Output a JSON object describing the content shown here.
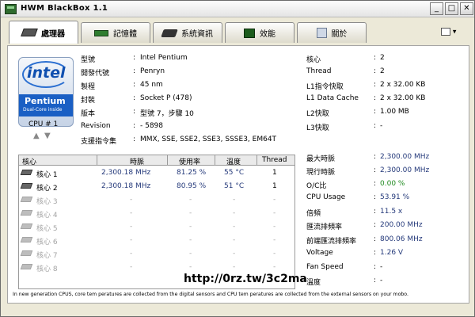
{
  "window": {
    "title": "HWM BlackBox 1.1"
  },
  "tabs": [
    {
      "label": "處理器"
    },
    {
      "label": "記憶體"
    },
    {
      "label": "系統資訊"
    },
    {
      "label": "效能"
    },
    {
      "label": "關於"
    }
  ],
  "logo": {
    "brand": "intel",
    "product": "Pentium",
    "sub": "Dual-Core inside"
  },
  "cpu_selector": {
    "label": "CPU # 1"
  },
  "cpu_info": [
    {
      "key": "型號",
      "value": "Intel Pentium"
    },
    {
      "key": "開發代號",
      "value": "Penryn"
    },
    {
      "key": "製程",
      "value": "45 nm"
    },
    {
      "key": "封裝",
      "value": "Socket P (478)"
    },
    {
      "key": "版本",
      "value": "型號 7，步驟 10"
    },
    {
      "key": "Revision",
      "value": "- 5898"
    },
    {
      "key": "支援指令集",
      "value": "MMX, SSE, SSE2, SSE3, SSSE3, EM64T"
    }
  ],
  "cache_info": [
    {
      "key": "核心",
      "value": "2"
    },
    {
      "key": "Thread",
      "value": "2"
    },
    {
      "key": "L1指令快取",
      "value": "2 x 32.00 KB"
    },
    {
      "key": "L1 Data Cache",
      "value": "2 x 32.00 KB"
    },
    {
      "key": "L2快取",
      "value": "1.00 MB"
    },
    {
      "key": "L3快取",
      "value": "-"
    }
  ],
  "core_table": {
    "headers": [
      "核心",
      "時脈",
      "使用率",
      "溫度",
      "Thread"
    ],
    "rows": [
      {
        "name": "核心 1",
        "clock": "2,300.18 MHz",
        "usage": "81.25 %",
        "temp": "55 °C",
        "thread": "1"
      },
      {
        "name": "核心 2",
        "clock": "2,300.18 MHz",
        "usage": "80.95 %",
        "temp": "51 °C",
        "thread": "1"
      },
      {
        "name": "核心 3",
        "clock": "-",
        "usage": "-",
        "temp": "-",
        "thread": "-"
      },
      {
        "name": "核心 4",
        "clock": "-",
        "usage": "-",
        "temp": "-",
        "thread": "-"
      },
      {
        "name": "核心 5",
        "clock": "-",
        "usage": "-",
        "temp": "-",
        "thread": "-"
      },
      {
        "name": "核心 6",
        "clock": "-",
        "usage": "-",
        "temp": "-",
        "thread": "-"
      },
      {
        "name": "核心 7",
        "clock": "-",
        "usage": "-",
        "temp": "-",
        "thread": "-"
      },
      {
        "name": "核心 8",
        "clock": "-",
        "usage": "-",
        "temp": "-",
        "thread": "-"
      }
    ]
  },
  "perf_info": [
    {
      "key": "最大時脈",
      "value": "2,300.00 MHz",
      "color": "#24397a"
    },
    {
      "key": "現行時脈",
      "value": "2,300.00 MHz",
      "color": "#24397a"
    },
    {
      "key": "O/C比",
      "value": "0.00 %",
      "color": "#1f8a1f"
    },
    {
      "key": "CPU Usage",
      "value": "53.91 %",
      "color": "#24397a"
    },
    {
      "key": "倍頻",
      "value": "11.5 x",
      "color": "#24397a"
    },
    {
      "key": "匯流排頻率",
      "value": "200.00 MHz",
      "color": "#24397a"
    },
    {
      "key": "前端匯流排頻率",
      "value": "800.06 MHz",
      "color": "#24397a"
    },
    {
      "key": "Voltage",
      "value": "1.26 V",
      "color": "#24397a"
    },
    {
      "key": "Fan Speed",
      "value": "-",
      "color": "#000000"
    },
    {
      "key": "溫度",
      "value": "-",
      "color": "#000000"
    }
  ],
  "watermark": "http://0rz.tw/3c2ma",
  "footnote": "In new generation CPUS, core tem peratures are collected from  the digital sensors and CPU tem peratures are collected from the external sensors on your mobo."
}
